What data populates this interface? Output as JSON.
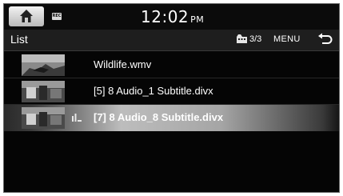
{
  "status": {
    "time": "12:02",
    "ampm": "PM",
    "rec_icon_label": "REC"
  },
  "header": {
    "title": "List",
    "folder_count": "3/3",
    "menu_label": "MENU"
  },
  "icons": {
    "home": "home-icon",
    "back": "back-arrow-icon",
    "folder": "video-folder-icon",
    "now_playing": "equalizer-icon"
  },
  "files": [
    {
      "name": "Wildlife.wmv",
      "selected": false
    },
    {
      "name": "[5] 8 Audio_1 Subtitle.divx",
      "selected": false
    },
    {
      "name": "[7] 8 Audio_8 Subtitle.divx",
      "selected": true
    }
  ],
  "colors": {
    "background": "#050505",
    "text": "#ffffff",
    "selection_highlight": "#bdbdbd"
  }
}
